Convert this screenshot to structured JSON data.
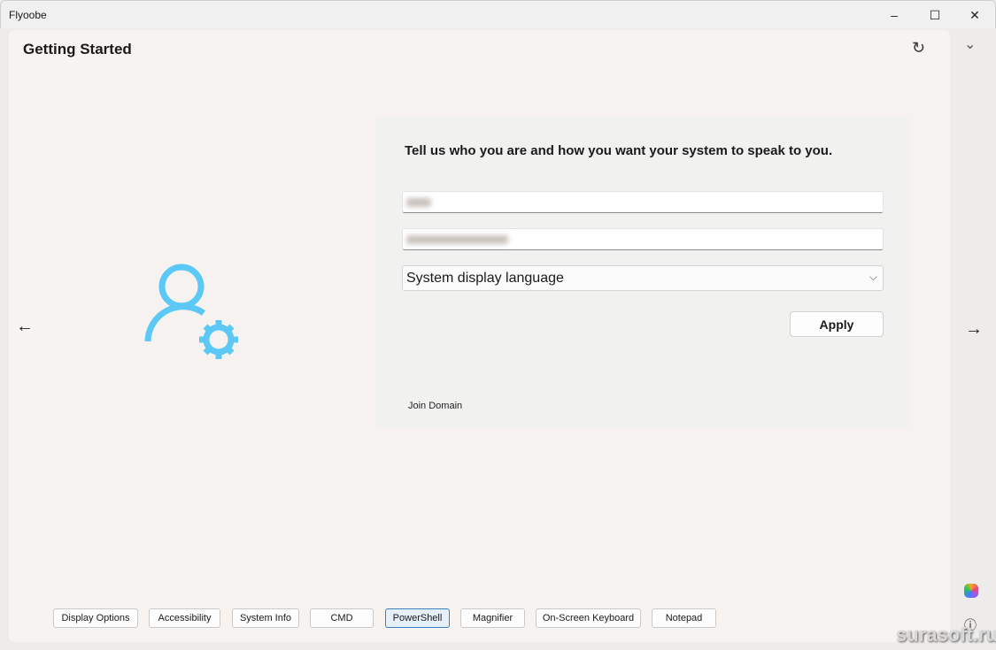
{
  "window": {
    "title": "Flyoobe",
    "minimize": "–",
    "maximize": "☐",
    "close": "✕"
  },
  "header": {
    "title": "Getting Started",
    "refresh_icon": "↻",
    "collapse_icon": "⌄"
  },
  "card": {
    "heading": "Tell us who you are and how you want your system to speak to you.",
    "language_select": "System display language",
    "apply": "Apply",
    "join_domain": "Join Domain"
  },
  "nav": {
    "back": "←",
    "next": "→"
  },
  "tools": [
    "Display Options",
    "Accessibility",
    "System Info",
    "CMD",
    "PowerShell",
    "Magnifier",
    "On-Screen Keyboard",
    "Notepad"
  ],
  "active_tool": "PowerShell",
  "rail": {
    "info": "ⓘ"
  },
  "watermark": "surasoft.ru",
  "colors": {
    "accent": "#5bc8f5"
  }
}
